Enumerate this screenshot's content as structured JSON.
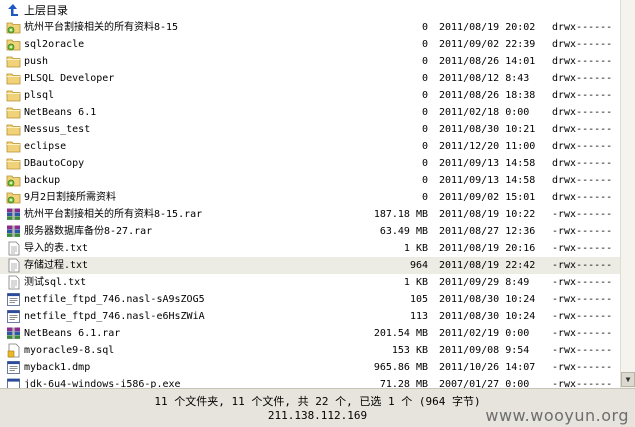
{
  "listing": {
    "up_label": "上层目录",
    "rows": [
      {
        "name": "杭州平台割接相关的所有资料8-15",
        "size": "0",
        "date": "2011/08/19 20:02",
        "perm": "drwx------",
        "icon": "folder-lock-icon"
      },
      {
        "name": "sql2oracle",
        "size": "0",
        "date": "2011/09/02 22:39",
        "perm": "drwx------",
        "icon": "folder-lock-icon"
      },
      {
        "name": "push",
        "size": "0",
        "date": "2011/08/26 14:01",
        "perm": "drwx------",
        "icon": "folder-icon"
      },
      {
        "name": "PLSQL Developer",
        "size": "0",
        "date": "2011/08/12 8:43",
        "perm": "drwx------",
        "icon": "folder-icon"
      },
      {
        "name": "plsql",
        "size": "0",
        "date": "2011/08/26 18:38",
        "perm": "drwx------",
        "icon": "folder-icon"
      },
      {
        "name": "NetBeans 6.1",
        "size": "0",
        "date": "2011/02/18 0:00",
        "perm": "drwx------",
        "icon": "folder-icon"
      },
      {
        "name": "Nessus_test",
        "size": "0",
        "date": "2011/08/30 10:21",
        "perm": "drwx------",
        "icon": "folder-icon"
      },
      {
        "name": "eclipse",
        "size": "0",
        "date": "2011/12/20 11:00",
        "perm": "drwx------",
        "icon": "folder-icon"
      },
      {
        "name": "DBautoCopy",
        "size": "0",
        "date": "2011/09/13 14:58",
        "perm": "drwx------",
        "icon": "folder-icon"
      },
      {
        "name": "backup",
        "size": "0",
        "date": "2011/09/13 14:58",
        "perm": "drwx------",
        "icon": "folder-lock-icon"
      },
      {
        "name": "9月2日割接所需资料",
        "size": "0",
        "date": "2011/09/02 15:01",
        "perm": "drwx------",
        "icon": "folder-lock-icon"
      },
      {
        "name": "杭州平台割接相关的所有资料8-15.rar",
        "size": "187.18 MB",
        "date": "2011/08/19 10:22",
        "perm": "-rwx------",
        "icon": "rar-archive-icon"
      },
      {
        "name": "服务器数据库备份8-27.rar",
        "size": "63.49 MB",
        "date": "2011/08/27 12:36",
        "perm": "-rwx------",
        "icon": "rar-archive-icon"
      },
      {
        "name": "导入的表.txt",
        "size": "1 KB",
        "date": "2011/08/19 20:16",
        "perm": "-rwx------",
        "icon": "text-file-icon"
      },
      {
        "name": "存储过程.txt",
        "size": "964",
        "date": "2011/08/19 22:42",
        "perm": "-rwx------",
        "icon": "text-file-icon"
      },
      {
        "name": "测试sql.txt",
        "size": "1 KB",
        "date": "2011/09/29 8:49",
        "perm": "-rwx------",
        "icon": "text-file-icon"
      },
      {
        "name": "netfile_ftpd_746.nasl-sA9sZOG5",
        "size": "105",
        "date": "2011/08/30 10:24",
        "perm": "-rwx------",
        "icon": "generic-file-icon"
      },
      {
        "name": "netfile_ftpd_746.nasl-e6HsZWiA",
        "size": "113",
        "date": "2011/08/30 10:24",
        "perm": "-rwx------",
        "icon": "generic-file-icon"
      },
      {
        "name": "NetBeans 6.1.rar",
        "size": "201.54 MB",
        "date": "2011/02/19 0:00",
        "perm": "-rwx------",
        "icon": "rar-archive-icon"
      },
      {
        "name": "myoracle9-8.sql",
        "size": "153 KB",
        "date": "2011/09/08 9:54",
        "perm": "-rwx------",
        "icon": "sql-file-icon"
      },
      {
        "name": "myback1.dmp",
        "size": "965.86 MB",
        "date": "2011/10/26 14:07",
        "perm": "-rwx------",
        "icon": "generic-file-icon"
      },
      {
        "name": "jdk-6u4-windows-i586-p.exe",
        "size": "71.28 MB",
        "date": "2007/01/27 0:00",
        "perm": "-rwx------",
        "icon": "exe-file-icon"
      }
    ]
  },
  "status": {
    "summary": "11 个文件夹, 11 个文件, 共 22 个, 已选 1 个 (964 字节)",
    "ip": "211.138.112.169"
  },
  "watermark": "www.wooyun.org"
}
